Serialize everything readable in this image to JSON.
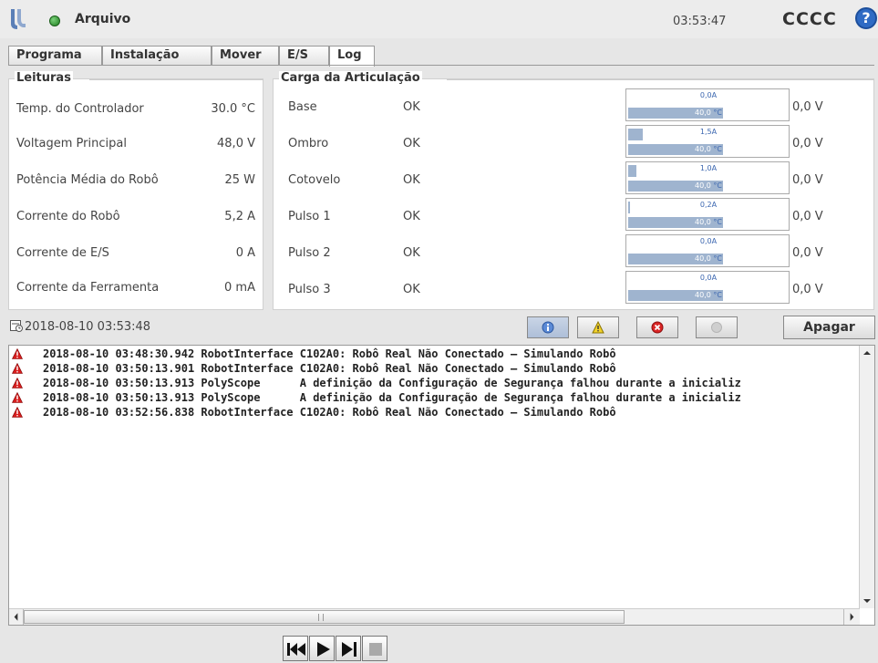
{
  "header": {
    "title": "Arquivo",
    "clock": "03:53:47",
    "robot_name": "CCCC",
    "help_glyph": "?"
  },
  "tabs": [
    {
      "label": "Programa",
      "active": false
    },
    {
      "label": "Instalação",
      "active": false
    },
    {
      "label": "Mover",
      "active": false
    },
    {
      "label": "E/S",
      "active": false
    },
    {
      "label": "Log",
      "active": true
    }
  ],
  "readings": {
    "title": "Leituras",
    "items": [
      {
        "label": "Temp. do Controlador",
        "value": "30.0 °C"
      },
      {
        "label": "Voltagem Principal",
        "value": "48,0  V"
      },
      {
        "label": "Potência Média do Robô",
        "value": "25  W"
      },
      {
        "label": "Corrente do Robô",
        "value": "5,2  A"
      },
      {
        "label": "Corrente de E/S",
        "value": "0  A"
      },
      {
        "label": "Corrente da Ferramenta",
        "value": "0 mA"
      }
    ]
  },
  "joint_load": {
    "title": "Carga da Articulação",
    "joints": [
      {
        "name": "Base",
        "status": "OK",
        "current": "0,0A",
        "current_fraction": 0.0,
        "temperature": "40,0",
        "temp_unit": "°C",
        "voltage": "0,0 V"
      },
      {
        "name": "Ombro",
        "status": "OK",
        "current": "1,5A",
        "current_fraction": 0.09,
        "temperature": "40,0",
        "temp_unit": "°C",
        "voltage": "0,0 V"
      },
      {
        "name": "Cotovelo",
        "status": "OK",
        "current": "1,0A",
        "current_fraction": 0.05,
        "temperature": "40,0",
        "temp_unit": "°C",
        "voltage": "0,0 V"
      },
      {
        "name": "Pulso 1",
        "status": "OK",
        "current": "0,2A",
        "current_fraction": 0.01,
        "temperature": "40,0",
        "temp_unit": "°C",
        "voltage": "0,0 V"
      },
      {
        "name": "Pulso 2",
        "status": "OK",
        "current": "0,0A",
        "current_fraction": 0.0,
        "temperature": "40,0",
        "temp_unit": "°C",
        "voltage": "0,0 V"
      },
      {
        "name": "Pulso 3",
        "status": "OK",
        "current": "0,0A",
        "current_fraction": 0.0,
        "temperature": "40,0",
        "temp_unit": "°C",
        "voltage": "0,0 V"
      }
    ]
  },
  "log": {
    "date": "2018-08-10 03:53:48",
    "clear_label": "Apagar",
    "filters": [
      {
        "icon": "info-icon",
        "active": true
      },
      {
        "icon": "warning-icon",
        "active": false
      },
      {
        "icon": "error-icon",
        "active": false
      },
      {
        "icon": "disabled-icon",
        "active": false
      }
    ],
    "entries": [
      {
        "icon": "error-triangle-icon",
        "text": "2018-08-10 03:48:30.942 RobotInterface C102A0: Robô Real Não Conectado – Simulando Robô"
      },
      {
        "icon": "error-triangle-icon",
        "text": "2018-08-10 03:50:13.901 RobotInterface C102A0: Robô Real Não Conectado – Simulando Robô"
      },
      {
        "icon": "error-triangle-icon",
        "text": "2018-08-10 03:50:13.913 PolyScope      A definição da Configuração de Segurança falhou durante a inicializ"
      },
      {
        "icon": "error-triangle-icon",
        "text": "2018-08-10 03:50:13.913 PolyScope      A definição da Configuração de Segurança falhou durante a inicializ"
      },
      {
        "icon": "error-triangle-icon",
        "text": "2018-08-10 03:52:56.838 RobotInterface C102A0: Robô Real Não Conectado – Simulando Robô"
      }
    ]
  },
  "playback": [
    "skip-back-icon",
    "play-icon",
    "step-forward-icon",
    "stop-icon"
  ]
}
